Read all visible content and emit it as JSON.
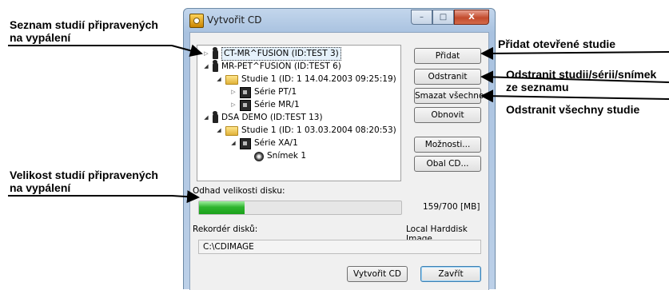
{
  "annotations": {
    "prepared_studies": [
      "Seznam studií připravených",
      "na vypálení"
    ],
    "add_open": "Přidat otevřené studie",
    "remove_from_list": [
      "Odstranit studii/sérii/snímek",
      "ze seznamu"
    ],
    "remove_all": "Odstranit všechny studie",
    "size_prepared": [
      "Velikost studií připravených",
      "na vypálení"
    ]
  },
  "window": {
    "title": "Vytvořit CD",
    "minimize": "–",
    "maximize": "□",
    "close": "X"
  },
  "tree": [
    {
      "label": "CT-MR^FUSION (ID:TEST 3)",
      "icon": "patient-icon",
      "expander": "▷",
      "selected": true
    },
    {
      "label": "MR-PET^FUSION (ID:TEST 6)",
      "icon": "patient-icon",
      "expander": "◢"
    },
    {
      "label": "Studie 1 (ID: 1 14.04.2003 09:25:19)",
      "icon": "folder-icon",
      "expander": "◢"
    },
    {
      "label": "Série PT/1",
      "icon": "series-icon",
      "expander": "▷"
    },
    {
      "label": "Série MR/1",
      "icon": "series-icon",
      "expander": "▷"
    },
    {
      "label": "DSA DEMO (ID:TEST 13)",
      "icon": "patient-icon",
      "expander": "◢"
    },
    {
      "label": "Studie 1 (ID: 1 03.03.2004 08:20:53)",
      "icon": "folder-icon",
      "expander": "◢"
    },
    {
      "label": "Série XA/1",
      "icon": "series-icon",
      "expander": "◢"
    },
    {
      "label": "Snímek 1",
      "icon": "image-icon",
      "expander": ""
    }
  ],
  "buttons": {
    "add": "Přidat",
    "remove": "Odstranit",
    "remove_all": "Smazat všechno",
    "refresh": "Obnovit",
    "options": "Možnosti...",
    "cover": "Obal CD...",
    "create": "Vytvořit CD",
    "close": "Zavřít"
  },
  "disk_estimate": {
    "label": "Odhad velikosti disku:",
    "used_mb": 159,
    "capacity_mb": 700,
    "text": "159/700 [MB]"
  },
  "recorder": {
    "label": "Rekordér disků:",
    "device": "Local Harddisk Image",
    "path": "C:\\CDIMAGE"
  },
  "colors": {
    "progress": "#2fb52f",
    "titlebar": "#b5cae4",
    "close": "#c34b2d"
  }
}
